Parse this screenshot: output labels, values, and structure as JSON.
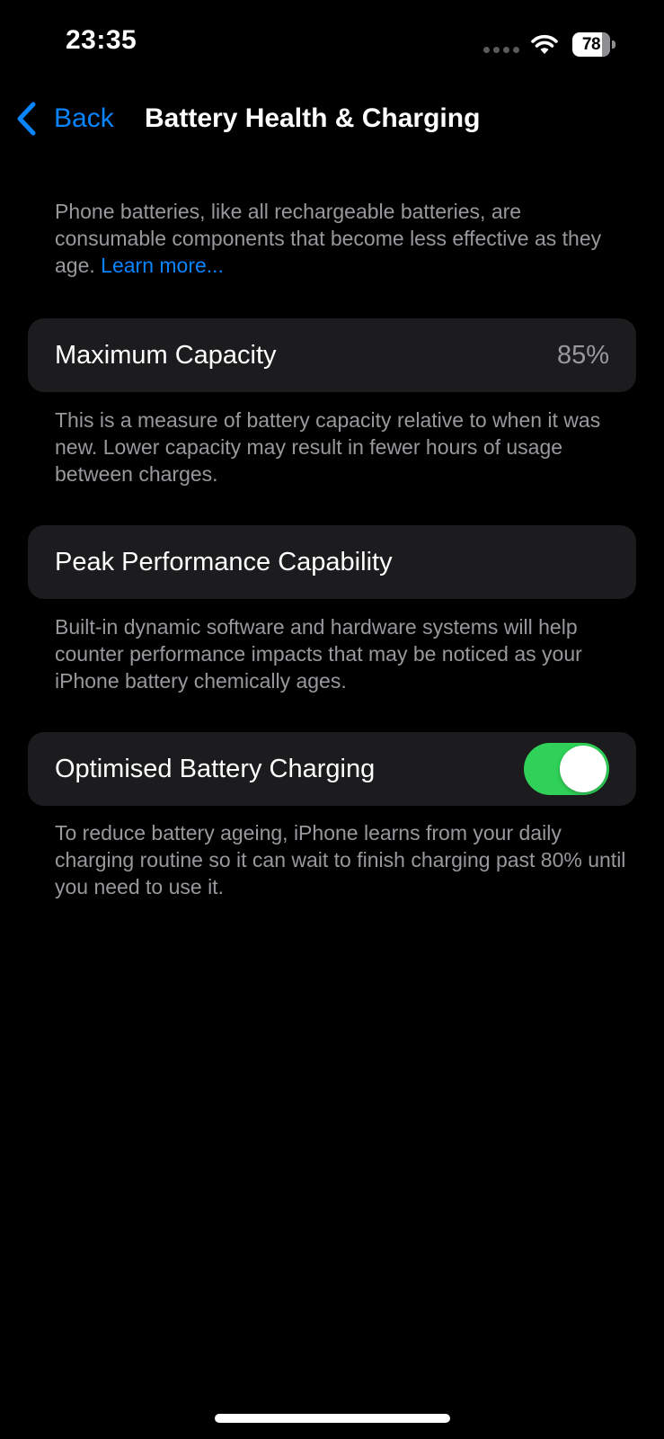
{
  "status_bar": {
    "time": "23:35",
    "battery_level": "78",
    "battery_fraction": 0.78,
    "icons": [
      "signal-dots-icon",
      "wifi-icon",
      "battery-icon"
    ]
  },
  "nav": {
    "back_label": "Back",
    "title": "Battery Health & Charging"
  },
  "intro": {
    "text": "Phone batteries, like all rechargeable batteries, are consumable components that become less effective as they age. ",
    "link": "Learn more..."
  },
  "maximum_capacity": {
    "label": "Maximum Capacity",
    "value": "85%",
    "footnote": "This is a measure of battery capacity relative to when it was new. Lower capacity may result in fewer hours of usage between charges."
  },
  "peak_performance": {
    "label": "Peak Performance Capability",
    "footnote": "Built-in dynamic software and hardware systems will help counter performance impacts that may be noticed as your iPhone battery chemically ages."
  },
  "optimised_charging": {
    "label": "Optimised Battery Charging",
    "enabled": true,
    "footnote": "To reduce battery ageing, iPhone learns from your daily charging routine so it can wait to finish charging past 80% until you need to use it."
  },
  "colors": {
    "accent": "#0a84ff",
    "toggle_on": "#30d158",
    "card_bg": "#1c1c1e",
    "secondary_text": "#98989d"
  }
}
